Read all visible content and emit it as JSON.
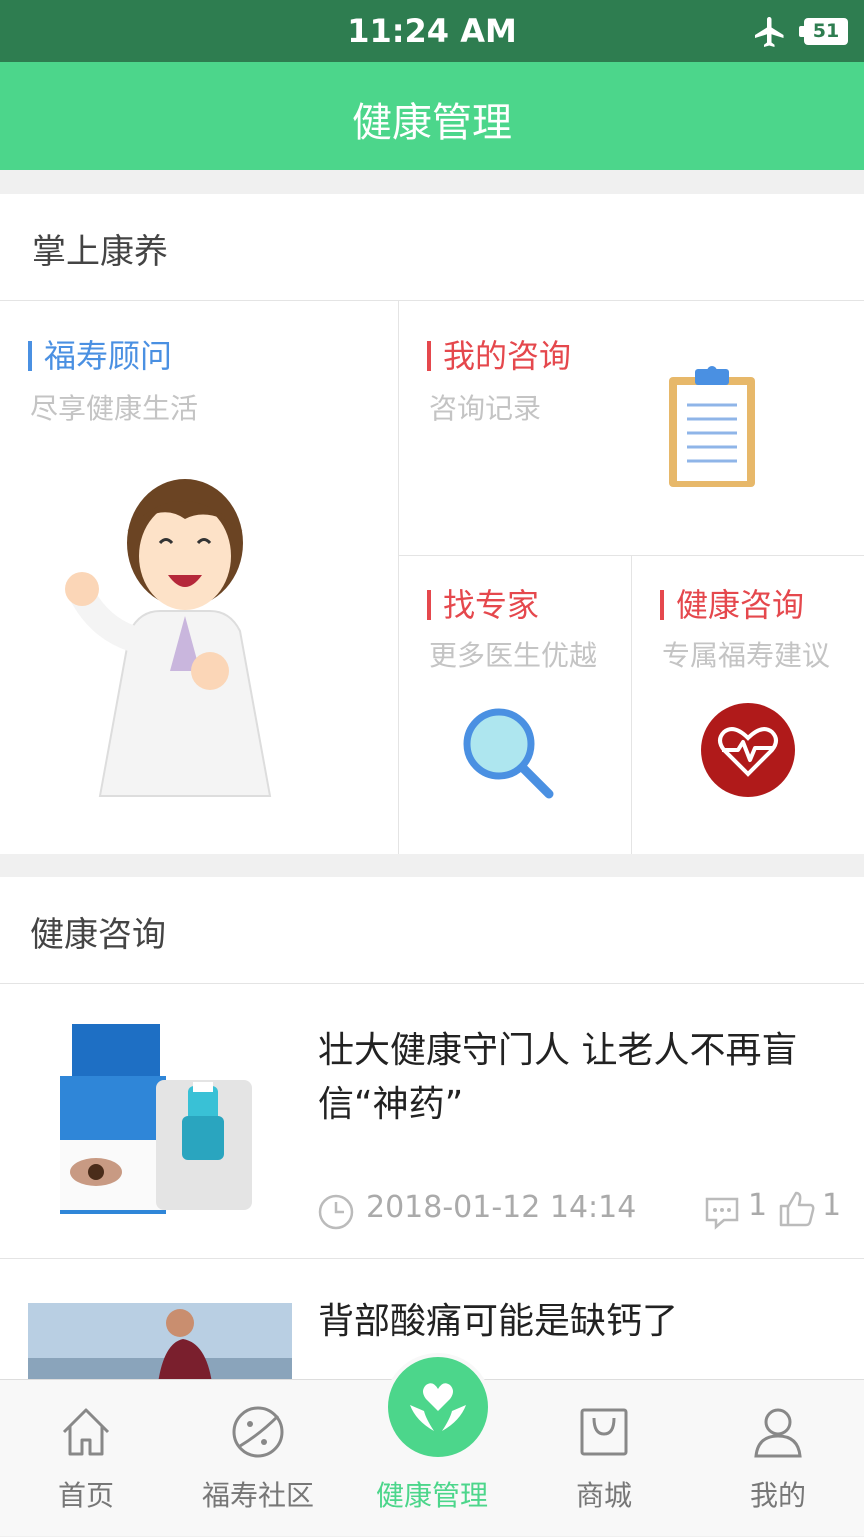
{
  "status_bar": {
    "time": "11:24 AM",
    "battery": "51"
  },
  "header": {
    "title": "健康管理"
  },
  "section1": {
    "title": "掌上康养",
    "tiles": [
      {
        "title": "福寿顾问",
        "subtitle": "尽享健康生活",
        "accent": "#4a90e2"
      },
      {
        "title": "我的咨询",
        "subtitle": "咨询记录",
        "accent": "#e5484d"
      },
      {
        "title": "找专家",
        "subtitle": "更多医生优越",
        "accent": "#e5484d"
      },
      {
        "title": "健康咨询",
        "subtitle": "专属福寿建议",
        "accent": "#e5484d"
      }
    ]
  },
  "section2": {
    "title": "健康咨询",
    "articles": [
      {
        "title": "壮大健康守门人 让老人不再盲信“神药”",
        "time": "2018-01-12 14:14",
        "comments": "1",
        "likes": "1"
      },
      {
        "title": "背部酸痛可能是缺钙了"
      }
    ]
  },
  "tabbar": {
    "items": [
      {
        "label": "首页",
        "icon": "home-icon"
      },
      {
        "label": "福寿社区",
        "icon": "planet-icon"
      },
      {
        "label": "健康管理",
        "icon": "heart-hands-icon",
        "active": true
      },
      {
        "label": "商城",
        "icon": "shopping-bag-icon"
      },
      {
        "label": "我的",
        "icon": "person-icon"
      }
    ],
    "active_color": "#4cd68b"
  },
  "colors": {
    "status_bar": "#2e7d50",
    "header": "#4cd68b",
    "accent_red": "#e5484d",
    "accent_blue": "#4a90e2"
  }
}
